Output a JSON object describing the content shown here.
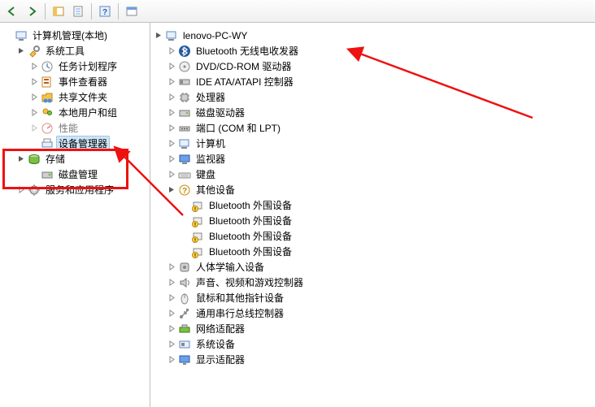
{
  "left_tree": {
    "root": {
      "label": "计算机管理(本地)"
    },
    "system_tools": {
      "label": "系统工具",
      "children": {
        "task_scheduler": "任务计划程序",
        "event_viewer": "事件查看器",
        "shared_folders": "共享文件夹",
        "local_users": "本地用户和组",
        "performance": "性能",
        "device_manager": "设备管理器"
      }
    },
    "storage": {
      "label": "存储",
      "children": {
        "disk_mgmt": "磁盘管理"
      }
    },
    "services_apps": {
      "label": "服务和应用程序"
    }
  },
  "right_tree": {
    "root": "lenovo-PC-WY",
    "items": [
      {
        "id": "bluetooth",
        "label": "Bluetooth 无线电收发器",
        "exp": "closed"
      },
      {
        "id": "dvdrom",
        "label": "DVD/CD-ROM 驱动器",
        "exp": "closed"
      },
      {
        "id": "ide",
        "label": "IDE ATA/ATAPI 控制器",
        "exp": "closed"
      },
      {
        "id": "cpu",
        "label": "处理器",
        "exp": "closed"
      },
      {
        "id": "diskdrive",
        "label": "磁盘驱动器",
        "exp": "closed"
      },
      {
        "id": "ports",
        "label": "端口 (COM 和 LPT)",
        "exp": "closed"
      },
      {
        "id": "computer",
        "label": "计算机",
        "exp": "closed"
      },
      {
        "id": "monitor",
        "label": "监视器",
        "exp": "closed"
      },
      {
        "id": "keyboard",
        "label": "键盘",
        "exp": "closed"
      },
      {
        "id": "otherdev",
        "label": "其他设备",
        "exp": "open",
        "children": [
          "Bluetooth 外围设备",
          "Bluetooth 外围设备",
          "Bluetooth 外围设备",
          "Bluetooth 外围设备"
        ]
      },
      {
        "id": "hid",
        "label": "人体学输入设备",
        "exp": "closed"
      },
      {
        "id": "audio",
        "label": "声音、视频和游戏控制器",
        "exp": "closed"
      },
      {
        "id": "mouse",
        "label": "鼠标和其他指针设备",
        "exp": "closed"
      },
      {
        "id": "usb",
        "label": "通用串行总线控制器",
        "exp": "closed"
      },
      {
        "id": "network",
        "label": "网络适配器",
        "exp": "closed"
      },
      {
        "id": "system",
        "label": "系统设备",
        "exp": "closed"
      },
      {
        "id": "display",
        "label": "显示适配器",
        "exp": "closed"
      }
    ]
  },
  "selected_left": "device_manager"
}
